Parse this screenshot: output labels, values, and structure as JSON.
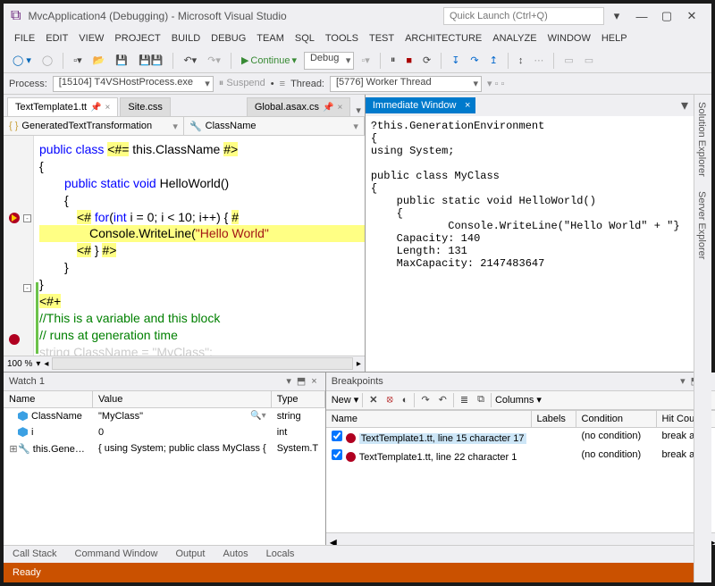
{
  "window": {
    "title": "MvcApplication4 (Debugging) - Microsoft Visual Studio",
    "quickLaunch": "Quick Launch (Ctrl+Q)"
  },
  "menu": [
    "FILE",
    "EDIT",
    "VIEW",
    "PROJECT",
    "BUILD",
    "DEBUG",
    "TEAM",
    "SQL",
    "TOOLS",
    "TEST",
    "ARCHITECTURE",
    "ANALYZE",
    "WINDOW",
    "HELP"
  ],
  "toolbar": {
    "continue": "Continue",
    "configCombo": "Debug"
  },
  "procbar": {
    "processLabel": "Process:",
    "process": "[15104] T4VSHostProcess.exe",
    "suspend": "Suspend",
    "threadLabel": "Thread:",
    "thread": "[5776] Worker Thread"
  },
  "editor": {
    "tabs": [
      {
        "label": "TextTemplate1.tt",
        "pinned": true,
        "active": true
      },
      {
        "label": "Site.css"
      },
      {
        "label": "Global.asax.cs",
        "pinned": true
      }
    ],
    "nav1": "GeneratedTextTransformation",
    "nav2": "ClassName",
    "zoom": "100 %",
    "code": {
      "l1a": "public class ",
      "l1b": "<#=",
      "l1c": " this.ClassName ",
      "l1d": "#>",
      "l2": "{",
      "l3a": "public static void",
      "l3b": " HelloWorld()",
      "l4": "{",
      "l5a": "<#",
      "l5b": " for",
      "l5c": "(",
      "l5d": "int",
      "l5e": " i = 0; i < 10; i++) { ",
      "l5f": "#",
      "l6a": "Console.WriteLine(",
      "l6b": "\"Hello World\"",
      "l7a": "<#",
      "l7b": " } ",
      "l7c": "#>",
      "l8": "}",
      "l9": "}",
      "l10": "<#+",
      "l11": "//This is a variable and this block",
      "l12": "// runs at generation time",
      "l13": "string ClassName = \"MyClass\";"
    }
  },
  "immediate": {
    "title": "Immediate Window",
    "body": "?this.GenerationEnvironment\n{\nusing System;\n\npublic class MyClass\n{\n    public static void HelloWorld()\n    {\n            Console.WriteLine(\"Hello World\" + \"}\n    Capacity: 140\n    Length: 131\n    MaxCapacity: 2147483647"
  },
  "watch": {
    "title": "Watch 1",
    "columns": [
      "Name",
      "Value",
      "Type"
    ],
    "rows": [
      {
        "icon": "cube",
        "name": "ClassName",
        "value": "\"MyClass\"",
        "type": "string",
        "mag": true
      },
      {
        "icon": "cube",
        "name": "i",
        "value": "0",
        "type": "int"
      },
      {
        "icon": "exp",
        "name": "this.Generati",
        "value": "{ using System;   public class MyClass {",
        "type": "System.T"
      }
    ]
  },
  "breakpoints": {
    "title": "Breakpoints",
    "new": "New",
    "columnsBtn": "Columns",
    "columns": [
      "Name",
      "Labels",
      "Condition",
      "Hit Count"
    ],
    "rows": [
      {
        "name": "TextTemplate1.tt, line 15 character 17",
        "cond": "(no condition)",
        "hit": "break alwa"
      },
      {
        "name": "TextTemplate1.tt, line 22 character 1",
        "cond": "(no condition)",
        "hit": "break alwa"
      }
    ]
  },
  "sideTabs": [
    "Solution Explorer",
    "Server Explorer"
  ],
  "bottomTabs": [
    "Call Stack",
    "Command Window",
    "Output",
    "Autos",
    "Locals"
  ],
  "status": "Ready"
}
